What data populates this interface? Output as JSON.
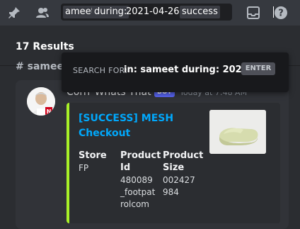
{
  "toolbar": {
    "icons": [
      "pin-icon",
      "members-icon",
      "inbox-icon",
      "help-icon"
    ]
  },
  "search": {
    "chip_user": "ameet",
    "chip_during": "during:",
    "date_value": "2021-04-26",
    "chip_success": "success",
    "popup_label": "SEARCH FOR:",
    "popup_query": "in: sameet during: 2021-...",
    "popup_enter": "ENTER"
  },
  "results": {
    "count_text": "17 Results",
    "channel_name": "# sameet"
  },
  "message": {
    "author": "Corrr Whats That",
    "bot_tag": "BOT",
    "timestamp": "Today at 7:48 AM",
    "embed": {
      "title_line1": "[SUCCESS] MESH",
      "title_line2": "Checkout",
      "accent_color": "#a8f028",
      "fields": [
        {
          "name": "Store",
          "value_lines": [
            "FP"
          ]
        },
        {
          "name_lines": [
            "Product",
            "Id"
          ],
          "value_lines": [
            "480089",
            "_footpat",
            "rolcom"
          ]
        },
        {
          "name_lines": [
            "Product",
            "Size"
          ],
          "value_lines": [
            "002427",
            "984"
          ]
        }
      ]
    }
  }
}
